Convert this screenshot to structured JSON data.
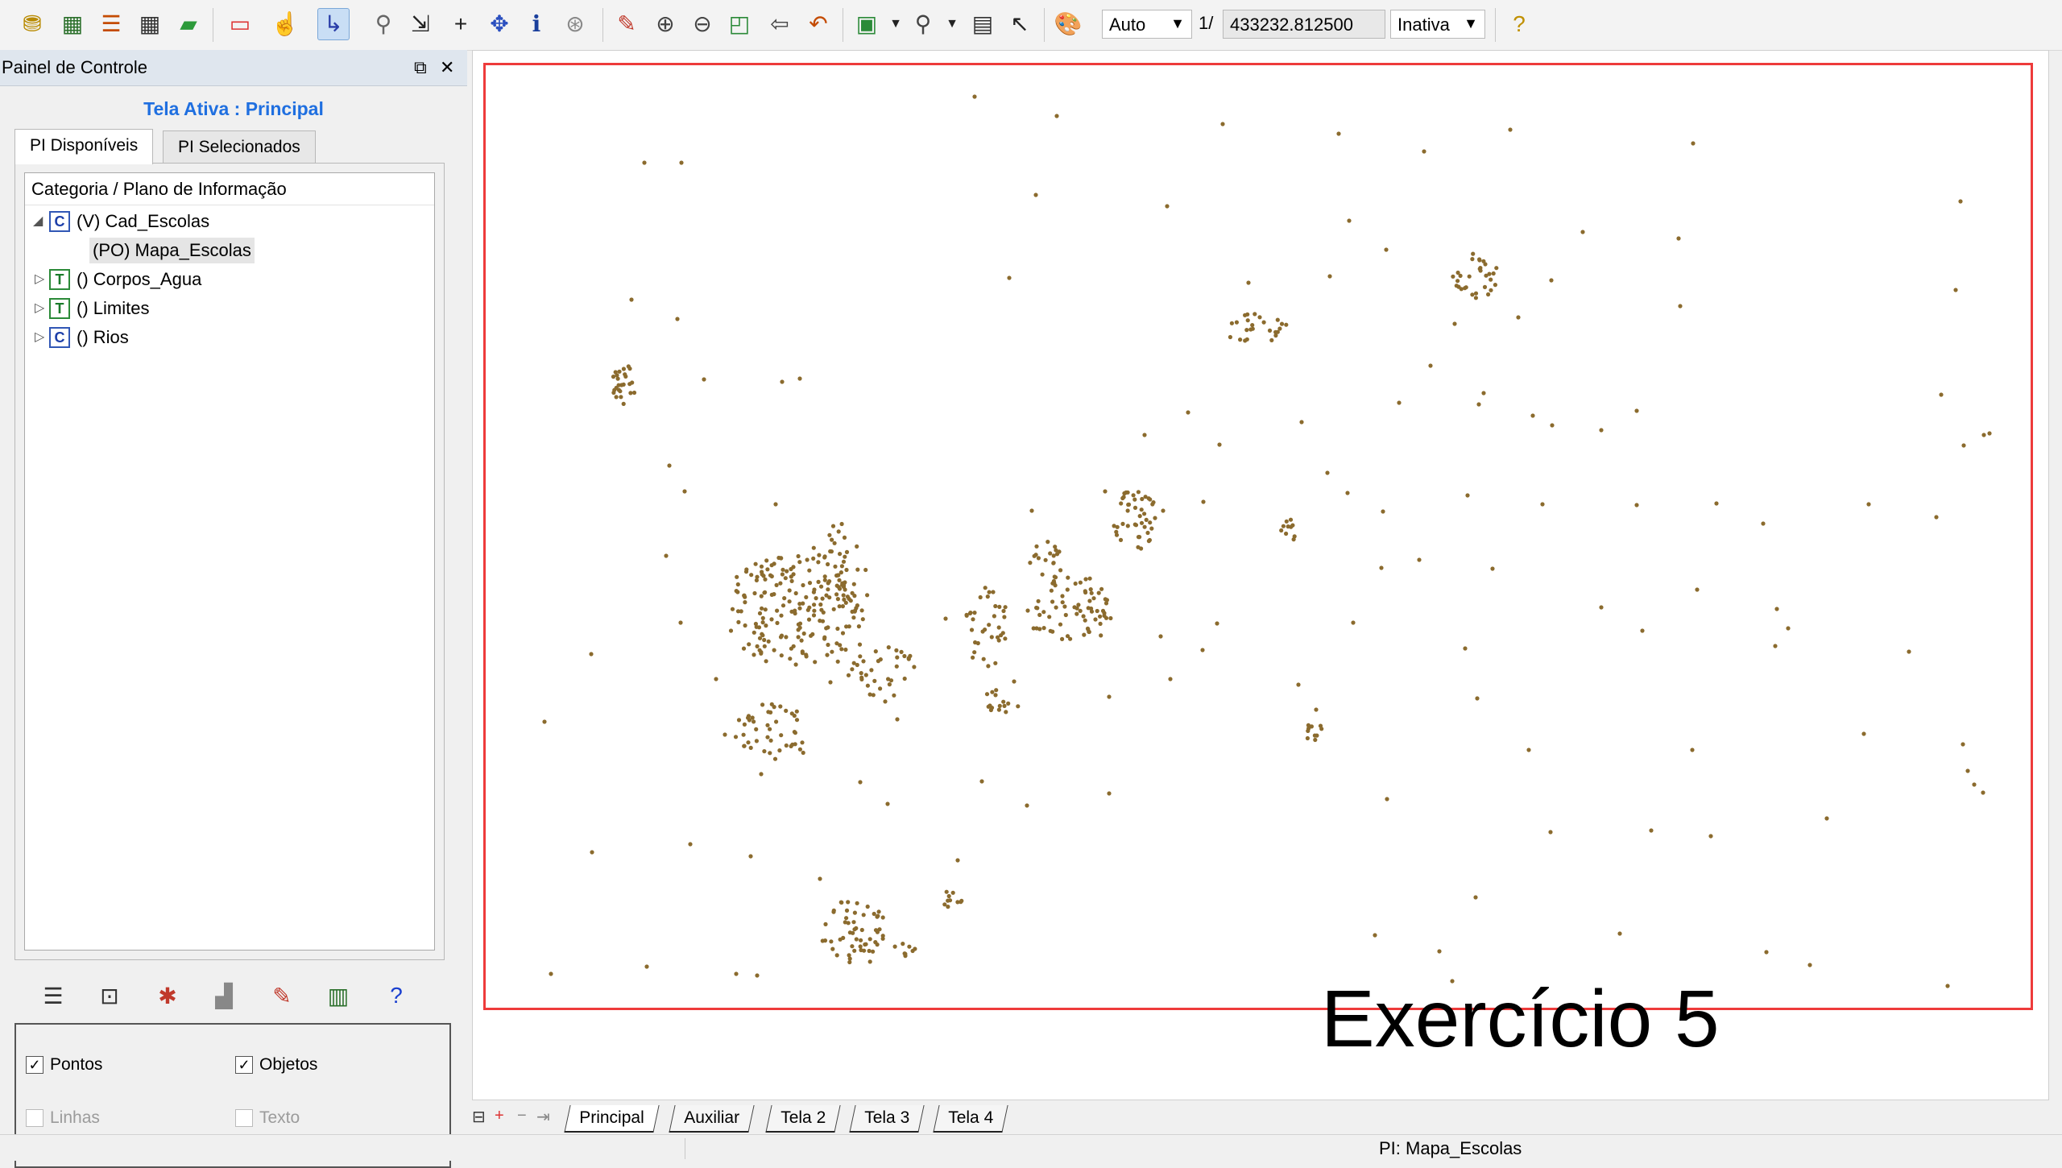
{
  "toolbar": {
    "scale_mode": "Auto",
    "scale_prefix": "1/",
    "scale_value": "433232.812500",
    "status_mode": "Inativa",
    "icons": [
      "database-icon",
      "table-icon",
      "layers-icon",
      "grid-icon",
      "eraser-icon",
      "frame-icon",
      "cursor-icon",
      "chart-icon",
      "search-icon",
      "import-icon",
      "plus-icon",
      "move-icon",
      "info-icon",
      "tag-icon",
      "pencil-icon",
      "zoom-in-icon",
      "zoom-out-icon",
      "zoom-area-icon",
      "back-icon",
      "undo-icon",
      "print-icon",
      "zoom-menu-icon",
      "map-icon",
      "select-icon",
      "palette-icon",
      "help-icon"
    ]
  },
  "panel": {
    "title": "Painel de Controle",
    "active_screen": "Tela Ativa : Principal",
    "tabs": [
      "PI Disponíveis",
      "PI Selecionados"
    ],
    "tree_header": "Categoria / Plano de Informação",
    "tree": [
      {
        "badge": "C",
        "label": "(V) Cad_Escolas",
        "expanded": true
      },
      {
        "label": "(PO) Mapa_Escolas",
        "child": true
      },
      {
        "badge": "T",
        "label": "() Corpos_Agua"
      },
      {
        "badge": "T",
        "label": "() Limites"
      },
      {
        "badge": "C",
        "label": "() Rios"
      }
    ],
    "options": {
      "pontos": "Pontos",
      "objetos": "Objetos",
      "linhas": "Linhas",
      "texto": "Texto"
    }
  },
  "map": {
    "point_color": "#8b6b2e",
    "frame_color": "#ee3b3b",
    "overlay": "Exercício 5"
  },
  "screen_tabs": [
    "Principal",
    "Auxiliar",
    "Tela 2",
    "Tela 3",
    "Tela 4"
  ],
  "status": {
    "text": "PI: Mapa_Escolas"
  }
}
